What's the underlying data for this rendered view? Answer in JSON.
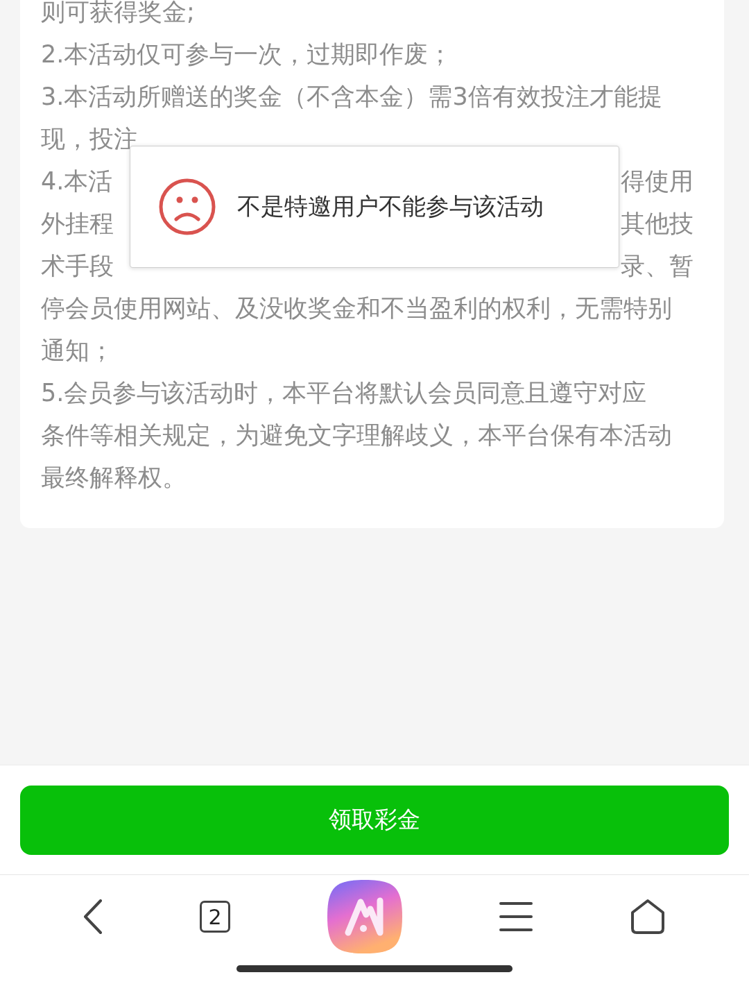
{
  "rules": [
    {
      "kind": "full",
      "text": "则可获得奖金;"
    },
    {
      "kind": "full",
      "text": "2.本活动仅可参与一次，过期即作废；"
    },
    {
      "kind": "full",
      "text": "3.本活动所赠送的奖金（不含本金）需3倍有效投注才能提"
    },
    {
      "kind": "full",
      "text": "现，投注"
    },
    {
      "kind": "split",
      "left": "4.本活",
      "right": "得使用"
    },
    {
      "kind": "split",
      "left": "外挂程",
      "right": "其他技"
    },
    {
      "kind": "split",
      "left": "术手段",
      "right": "录、暂"
    },
    {
      "kind": "full",
      "text": "停会员使用网站、及没收奖金和不当盈利的权利，无需特别"
    },
    {
      "kind": "full",
      "text": "通知；"
    },
    {
      "kind": "full",
      "text": "5.会员参与该活动时，本平台将默认会员同意且遵守对应"
    },
    {
      "kind": "full",
      "text": "条件等相关规定，为避免文字理解歧义，本平台保有本活动"
    },
    {
      "kind": "full",
      "text": "最终解释权。"
    }
  ],
  "toast": {
    "message": "不是特邀用户不能参与该活动"
  },
  "claim_button": {
    "label": "领取彩金"
  },
  "browser_bar": {
    "tab_count": "2"
  }
}
